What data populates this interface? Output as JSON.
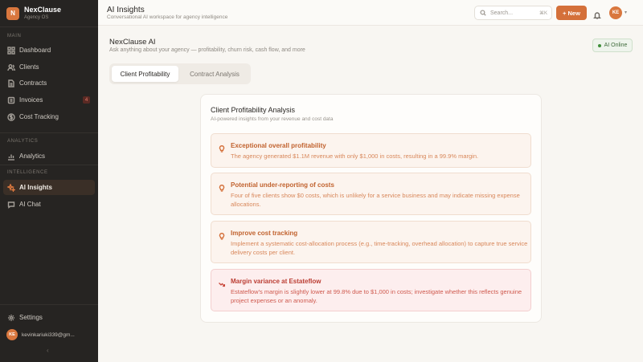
{
  "app": {
    "name": "NexClause",
    "subtitle": "Agency OS",
    "logo_letter": "N",
    "accent": "#d9773e"
  },
  "sidebar": {
    "sections": {
      "main": "MAIN",
      "analytics": "ANALYTICS",
      "intelligence": "INTELLIGENCE"
    },
    "items": [
      {
        "label": "Dashboard",
        "icon": "grid-icon"
      },
      {
        "label": "Clients",
        "icon": "users-icon"
      },
      {
        "label": "Contracts",
        "icon": "document-icon"
      },
      {
        "label": "Invoices",
        "icon": "receipt-icon",
        "badge": "4"
      },
      {
        "label": "Cost Tracking",
        "icon": "dollar-icon"
      },
      {
        "label": "Analytics",
        "icon": "chart-icon"
      },
      {
        "label": "AI Insights",
        "icon": "sparkle-icon",
        "active": true
      },
      {
        "label": "AI Chat",
        "icon": "chat-icon"
      }
    ],
    "settings_label": "Settings",
    "user_initials": "KE",
    "user_email": "kevinkariuki339@gm...",
    "collapse_glyph": "‹"
  },
  "topbar": {
    "title": "AI Insights",
    "subtitle": "Conversational AI workspace for agency intelligence",
    "search_placeholder": "Search...",
    "search_shortcut": "⌘K",
    "new_label": "+ New",
    "avatar_initials": "KE"
  },
  "main": {
    "title": "NexClause AI",
    "subtitle": "Ask anything about your agency — profitability, churn risk, cash flow, and more",
    "status": "AI Online",
    "tabs": [
      {
        "label": "Client Profitability",
        "active": true
      },
      {
        "label": "Contract Analysis",
        "active": false
      }
    ],
    "panel": {
      "title": "Client Profitability Analysis",
      "subtitle": "AI-powered insights from your revenue and cost data",
      "insights": [
        {
          "title": "Exceptional overall profitability",
          "description": "The agency generated $1.1M revenue with only $1,000 in costs, resulting in a 99.9% margin.",
          "icon": "lightbulb-icon",
          "kind": "info"
        },
        {
          "title": "Potential under-reporting of costs",
          "description": "Four of five clients show $0 costs, which is unlikely for a service business and may indicate missing expense allocations.",
          "icon": "lightbulb-icon",
          "kind": "info"
        },
        {
          "title": "Improve cost tracking",
          "description": "Implement a systematic cost-allocation process (e.g., time-tracking, overhead allocation) to capture true service delivery costs per client.",
          "icon": "lightbulb-icon",
          "kind": "info"
        },
        {
          "title": "Margin variance at Estateflow",
          "description": "Estateflow's margin is slightly lower at 99.8% due to $1,000 in costs; investigate whether this reflects genuine project expenses or an anomaly.",
          "icon": "trending-down-icon",
          "kind": "danger"
        }
      ]
    }
  }
}
